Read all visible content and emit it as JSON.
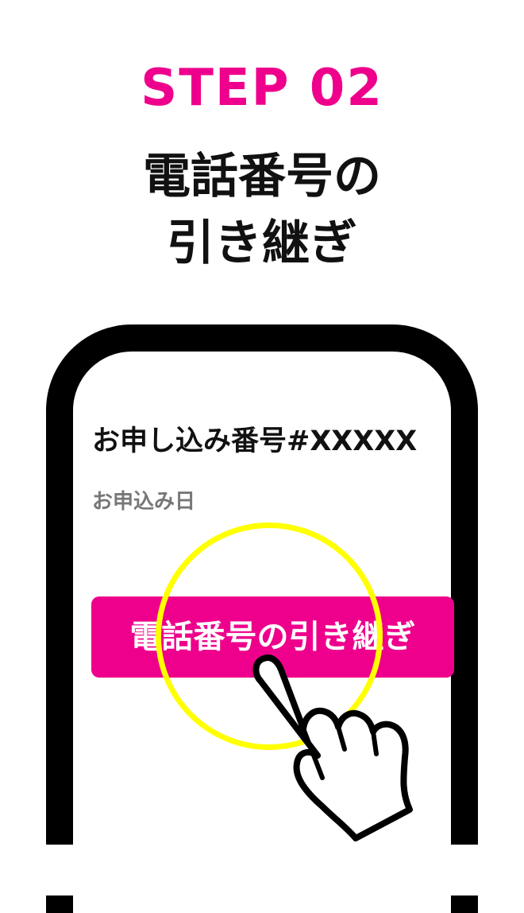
{
  "step": {
    "label": "STEP 02",
    "title_line1": "電話番号の",
    "title_line2": "引き継ぎ"
  },
  "screen": {
    "order_number": "お申し込み番号#XXXXX",
    "order_date_label": "お申込み日",
    "transfer_button_label": "電話番号の引き継ぎ"
  },
  "colors": {
    "accent": "#ee008c",
    "highlight": "#ffff00",
    "frame": "#000000"
  },
  "icons": {
    "pointer": "pointing-hand-icon"
  }
}
